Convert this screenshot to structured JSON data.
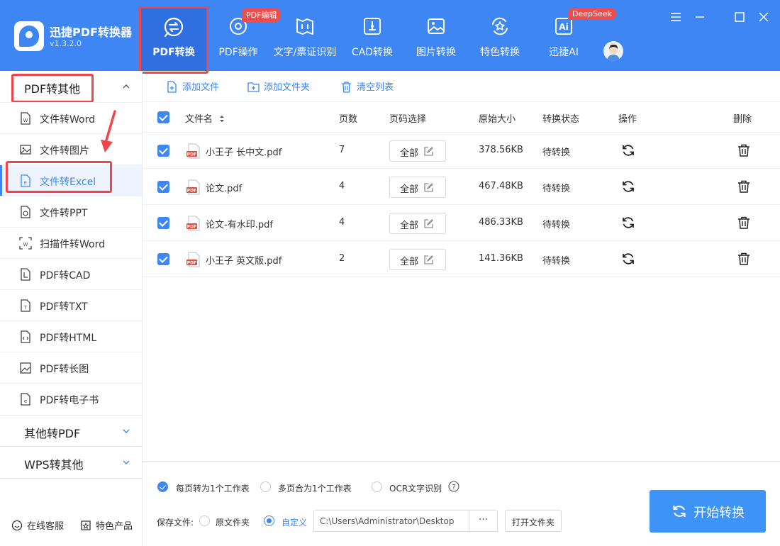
{
  "app": {
    "name": "迅捷PDF转换器",
    "version": "v1.3.2.0"
  },
  "nav": {
    "tabs": [
      {
        "label": "PDF转换",
        "icon": "convert-icon",
        "active": true
      },
      {
        "label": "PDF操作",
        "icon": "gear-icon",
        "badge": "PDF编辑"
      },
      {
        "label": "文字/票证识别",
        "icon": "ocr-icon"
      },
      {
        "label": "CAD转换",
        "icon": "cad-icon"
      },
      {
        "label": "图片转换",
        "icon": "image-icon"
      },
      {
        "label": "特色转换",
        "icon": "star-icon"
      },
      {
        "label": "迅捷AI",
        "icon": "ai-icon",
        "badge": "DeepSeek"
      }
    ]
  },
  "sidebar": {
    "groups": [
      {
        "label": "PDF转其他",
        "expanded": true
      },
      {
        "label": "其他转PDF",
        "expanded": false
      },
      {
        "label": "WPS转其他",
        "expanded": false
      }
    ],
    "items": [
      {
        "label": "文件转Word",
        "icon": "word-icon"
      },
      {
        "label": "文件转图片",
        "icon": "image-icon"
      },
      {
        "label": "文件转Excel",
        "icon": "excel-icon",
        "active": true
      },
      {
        "label": "文件转PPT",
        "icon": "ppt-icon"
      },
      {
        "label": "扫描件转Word",
        "icon": "scan-icon"
      },
      {
        "label": "PDF转CAD",
        "icon": "cad-icon"
      },
      {
        "label": "PDF转TXT",
        "icon": "txt-icon"
      },
      {
        "label": "PDF转HTML",
        "icon": "html-icon"
      },
      {
        "label": "PDF转长图",
        "icon": "long-image-icon"
      },
      {
        "label": "PDF转电子书",
        "icon": "ebook-icon"
      }
    ],
    "footer": {
      "service": "在线客服",
      "products": "特色产品"
    }
  },
  "toolbar": {
    "add_file": "添加文件",
    "add_folder": "添加文件夹",
    "clear_list": "清空列表"
  },
  "table": {
    "headers": {
      "name": "文件名",
      "pages": "页数",
      "range": "页码选择",
      "size": "原始大小",
      "status": "转换状态",
      "op": "操作",
      "delete": "删除"
    },
    "rows": [
      {
        "name": "小王子 长中文.pdf",
        "pages": "7",
        "range": "全部",
        "size": "378.56KB",
        "status": "待转换"
      },
      {
        "name": "论文.pdf",
        "pages": "4",
        "range": "全部",
        "size": "467.48KB",
        "status": "待转换"
      },
      {
        "name": "论文-有水印.pdf",
        "pages": "4",
        "range": "全部",
        "size": "486.33KB",
        "status": "待转换"
      },
      {
        "name": "小王子 英文版.pdf",
        "pages": "2",
        "range": "全部",
        "size": "141.36KB",
        "status": "待转换"
      }
    ]
  },
  "options": {
    "per_page_sheet": "每页转为1个工作表",
    "merge_sheet": "多页合为1个工作表",
    "ocr": "OCR文字识别",
    "save_label": "保存文件:",
    "original_folder": "原文件夹",
    "custom": "自定义",
    "path": "C:\\Users\\Administrator\\Desktop",
    "dots": "···",
    "open_folder": "打开文件夹",
    "start": "开始转换"
  },
  "colors": {
    "primary": "#3d86f3",
    "highlight": "#f0454c",
    "badge": "#f24b4b"
  }
}
